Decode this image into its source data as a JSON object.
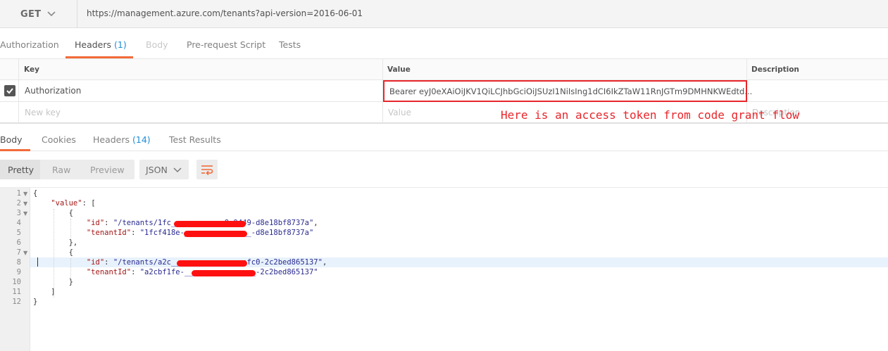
{
  "request": {
    "method": "GET",
    "url": "https://management.azure.com/tenants?api-version=2016-06-01"
  },
  "request_tabs": [
    {
      "label": "Authorization",
      "count": ""
    },
    {
      "label": "Headers",
      "count": "(1)"
    },
    {
      "label": "Body",
      "count": ""
    },
    {
      "label": "Pre-request Script",
      "count": ""
    },
    {
      "label": "Tests",
      "count": ""
    }
  ],
  "headers_table": {
    "columns": [
      "Key",
      "Value",
      "Description"
    ],
    "rows": [
      {
        "checked": true,
        "key": "Authorization",
        "value": "Bearer eyJ0eXAiOiJKV1QiLCJhbGciOiJSUzI1NiIsIng1dCI6IkZTaW11RnJGTm9DMHNKWEdtd..."
      }
    ],
    "new_row": {
      "key_placeholder": "New key",
      "value_placeholder": "Value",
      "description_placeholder": "Description"
    }
  },
  "annotation": "Here is an access token from code grant flow",
  "annotation_color": "#e8262b",
  "response_tabs": [
    {
      "label": "Body",
      "count": ""
    },
    {
      "label": "Cookies",
      "count": ""
    },
    {
      "label": "Headers",
      "count": "(14)"
    },
    {
      "label": "Test Results",
      "count": ""
    }
  ],
  "view_modes": [
    "Pretty",
    "Raw",
    "Preview"
  ],
  "selected_view_mode": "Pretty",
  "format": "JSON",
  "accent_color": "#f26b3a",
  "code_lines": [
    {
      "n": "1",
      "fold": true
    },
    {
      "n": "2",
      "fold": true
    },
    {
      "n": "3",
      "fold": true
    },
    {
      "n": "4",
      "fold": false
    },
    {
      "n": "5",
      "fold": false
    },
    {
      "n": "6",
      "fold": false
    },
    {
      "n": "7",
      "fold": true
    },
    {
      "n": "8",
      "fold": false
    },
    {
      "n": "9",
      "fold": false
    },
    {
      "n": "10",
      "fold": false
    },
    {
      "n": "11",
      "fold": false
    },
    {
      "n": "12",
      "fold": false
    }
  ],
  "code": {
    "l1": "{",
    "l2_key": "\"value\"",
    "l2_rest": ": [",
    "l3": "{",
    "l4_key": "\"id\"",
    "l4_val": "\"/tenants/1fc____________9-9449-d8e18bf8737a\"",
    "l5_key": "\"tenantId\"",
    "l5_val": "\"1fcf418e-_______________-d8e18bf8737a\"",
    "l6": "},",
    "l7": "{",
    "l8_key": "\"id\"",
    "l8_val": "\"/tenants/a2c_______________-afc0-2c2bed865137\"",
    "l9_key": "\"tenantId\"",
    "l9_val": "\"a2cbf1fe-________________-2c2bed865137\"",
    "l10": "}",
    "l11": "]",
    "l12": "}"
  },
  "highlighted_line": "8",
  "icons": [
    "chevron-down-icon",
    "checkbox-checked-icon",
    "wrap-lines-icon",
    "fold-arrow-icon"
  ]
}
